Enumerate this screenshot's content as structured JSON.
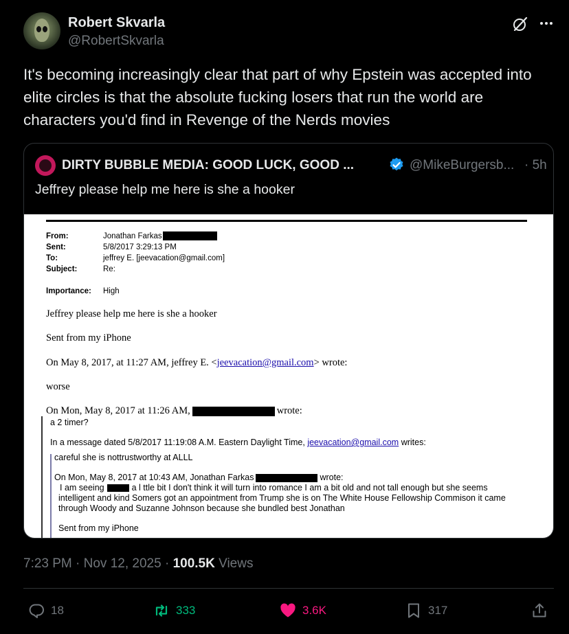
{
  "author": {
    "name": "Robert Skvarla",
    "handle": "@RobertSkvarla"
  },
  "tweet": {
    "text": "It's becoming increasingly clear that part of why Epstein was accepted into elite circles is that the absolute fucking losers that run the world are characters you'd find in Revenge of the Nerds movies"
  },
  "quoted": {
    "name": "DIRTY BUBBLE MEDIA: GOOD LUCK, GOOD ...",
    "handle": "@MikeBurgersb...",
    "time": "· 5h",
    "text": "Jeffrey please help me here is she a hooker"
  },
  "email": {
    "from_label": "From:",
    "from_value": "Jonathan Farkas",
    "sent_label": "Sent:",
    "sent_value": "5/8/2017 3:29:13 PM",
    "to_label": "To:",
    "to_value": "jeffrey E. [jeevacation@gmail.com]",
    "subject_label": "Subject:",
    "subject_value": "Re:",
    "importance_label": "Importance:",
    "importance_value": "High",
    "body1": "Jeffrey please help me here is she a hooker",
    "body2": "Sent from my iPhone",
    "reply1_prefix": "On May 8, 2017, at 11:27 AM, jeffrey E. <",
    "reply1_link": "jeevacation@gmail.com",
    "reply1_suffix": "> wrote:",
    "reply1_body": "worse",
    "reply2_prefix": "On Mon, May 8, 2017 at 11:26 AM,",
    "reply2_suffix": "wrote:",
    "reply2_body": "a 2 timer?",
    "reply3_prefix": "In a message dated 5/8/2017 11:19:08 A.M. Eastern Daylight Time,",
    "reply3_link": "jeevacation@gmail.com",
    "reply3_suffix": "writes:",
    "reply3_body": "careful  she is nottrustworthy at ALLL",
    "reply4_prefix": "On Mon, May 8, 2017 at 10:43 AM, Jonathan Farkas",
    "reply4_suffix": "wrote:",
    "reply4_body_a": "I am seeing",
    "reply4_body_b": "a l ttle bit I don't think it will turn into romance I am a bit old and not tall enough but she seems",
    "reply4_body_c": "intelligent and kind Somers got an appointment from Trump she is on The White House Fellowship Commison it came",
    "reply4_body_d": "through Woody and Suzanne Johnson because she bundled best Jonathan",
    "reply4_sig": "Sent from my iPhone"
  },
  "meta": {
    "timestamp": "7:23 PM · Nov 12, 2025 ·",
    "views_count": "100.5K",
    "views_label": "Views"
  },
  "actions": {
    "replies": "18",
    "reposts": "333",
    "likes": "3.6K",
    "bookmarks": "317"
  },
  "colors": {
    "background": "#000000",
    "text": "#e7e9ea",
    "muted": "#71767b",
    "repost": "#00ba7c",
    "like": "#f91880",
    "verified": "#1d9bf0"
  }
}
